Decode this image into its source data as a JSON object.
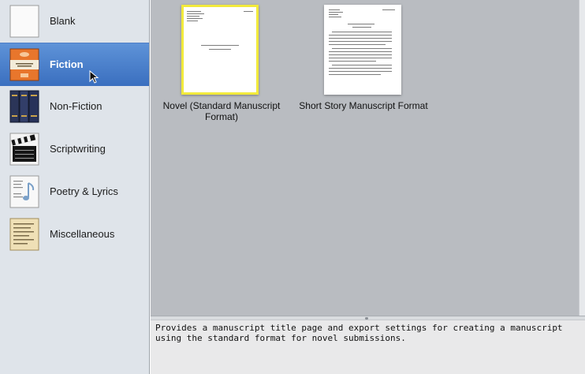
{
  "sidebar": {
    "items": [
      {
        "label": "Blank",
        "icon": "blank-page-icon"
      },
      {
        "label": "Fiction",
        "icon": "book-cover-icon"
      },
      {
        "label": "Non-Fiction",
        "icon": "books-icon"
      },
      {
        "label": "Scriptwriting",
        "icon": "clapperboard-icon"
      },
      {
        "label": "Poetry & Lyrics",
        "icon": "music-note-page-icon"
      },
      {
        "label": "Miscellaneous",
        "icon": "notes-page-icon"
      }
    ],
    "selected_index": 1
  },
  "templates": [
    {
      "label": "Novel (Standard Manuscript Format)",
      "selected": true
    },
    {
      "label": "Short Story Manuscript Format",
      "selected": false
    }
  ],
  "description": "Provides a manuscript title page and export settings for creating a manuscript using the standard format for novel submissions.",
  "colors": {
    "sidebar_bg": "#dfe4ea",
    "selection": "#3a6fbf",
    "grid_bg": "#b9bcc1",
    "thumb_selected_border": "#f2ea3c"
  }
}
